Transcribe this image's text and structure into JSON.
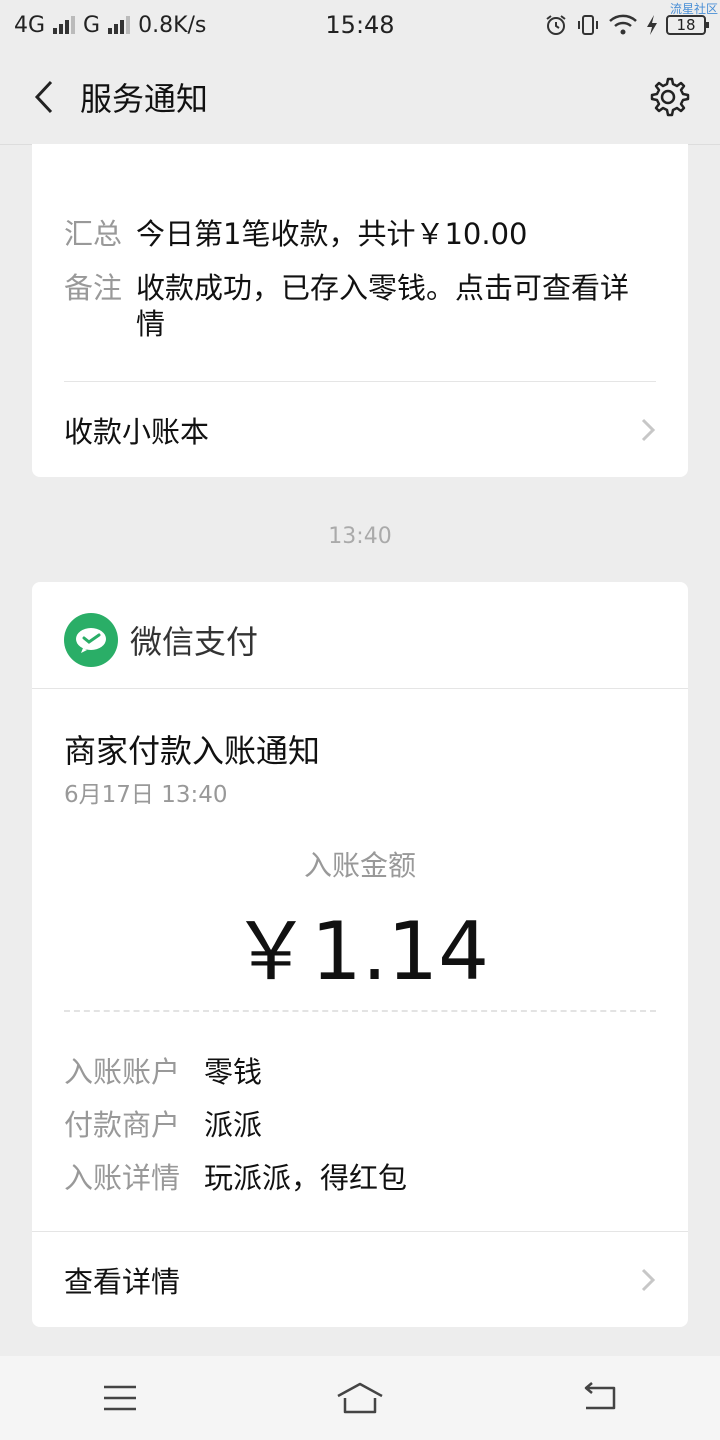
{
  "status_bar": {
    "network1": "4G",
    "network2": "G",
    "speed": "0.8K/s",
    "time": "15:48",
    "battery": "18",
    "watermark": "流星社区"
  },
  "nav": {
    "title": "服务通知"
  },
  "prev_card": {
    "summary_label": "汇总",
    "summary_value": "今日第1笔收款，共计￥10.00",
    "note_label": "备注",
    "note_value": "收款成功，已存入零钱。点击可查看详情",
    "link_label": "收款小账本"
  },
  "timestamp": "13:40",
  "card": {
    "app_name": "微信支付",
    "title": "商家付款入账通知",
    "date": "6月17日  13:40",
    "amount_label": "入账金额",
    "amount": "￥1.14",
    "rows": [
      {
        "k": "入账账户",
        "v": "零钱"
      },
      {
        "k": "付款商户",
        "v": "派派"
      },
      {
        "k": "入账详情",
        "v": "玩派派，得红包"
      }
    ],
    "link_label": "查看详情"
  },
  "colors": {
    "wechat_green": "#2aae67",
    "background": "#ededed"
  }
}
